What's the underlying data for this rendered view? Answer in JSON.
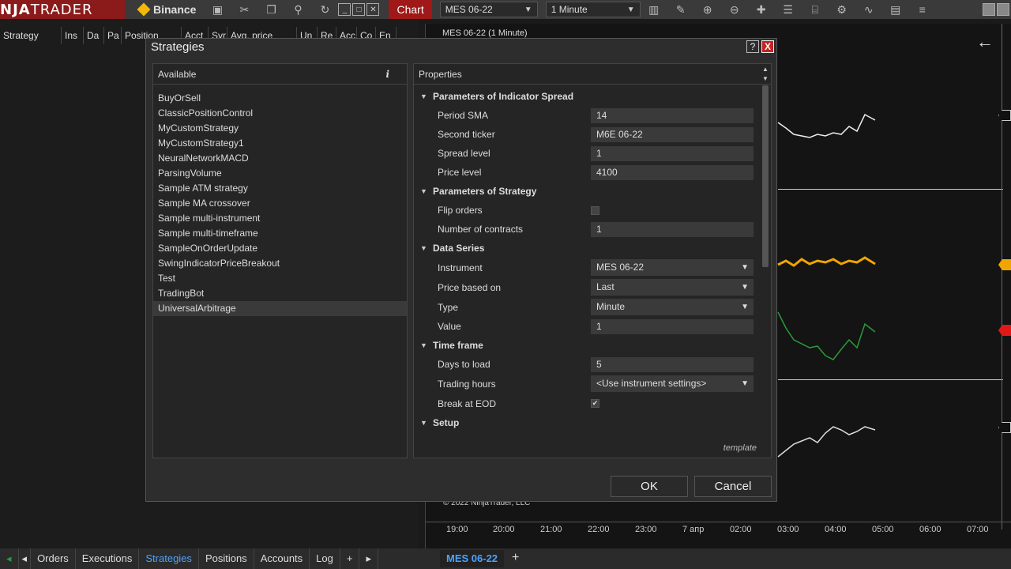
{
  "topbar": {
    "logo_prefix": "NJA",
    "logo_suffix": "TRADER",
    "connection": "Binance",
    "chart_tab": "Chart",
    "instrument": "MES 06-22",
    "interval": "1 Minute"
  },
  "grid": {
    "columns": [
      "Strategy",
      "Ins",
      "Da",
      "Pa",
      "Position",
      "Acct",
      "Syr",
      "Avg. price",
      "Un",
      "Re",
      "Acc",
      "Co",
      "En"
    ]
  },
  "chart": {
    "title": "MES 06-22 (1 Minute)",
    "copyright": "© 2022 NinjaTrader, LLC",
    "time_ticks": [
      "19:00",
      "20:00",
      "21:00",
      "22:00",
      "23:00",
      "7 апр",
      "02:00",
      "03:00",
      "04:00",
      "05:00",
      "06:00",
      "07:00"
    ],
    "marker_colors": [
      "#f0a500",
      "#e01818"
    ]
  },
  "bottom_tabs": [
    "Orders",
    "Executions",
    "Strategies",
    "Positions",
    "Accounts",
    "Log"
  ],
  "chart_tab_label": "MES 06-22",
  "dialog": {
    "title": "Strategies",
    "help": "?",
    "close": "X",
    "available_header": "Available",
    "available_info": "i",
    "available": [
      "BuyOrSell",
      "ClassicPositionControl",
      "MyCustomStrategy",
      "MyCustomStrategy1",
      "NeuralNetworkMACD",
      "ParsingVolume",
      "Sample ATM strategy",
      "Sample MA crossover",
      "Sample multi-instrument",
      "Sample multi-timeframe",
      "SampleOnOrderUpdate",
      "SwingIndicatorPriceBreakout",
      "Test",
      "TradingBot",
      "UniversalArbitrage"
    ],
    "selected": "UniversalArbitrage",
    "properties_header": "Properties",
    "categories": {
      "indicator": "Parameters of Indicator Spread",
      "strategy": "Parameters of Strategy",
      "data_series": "Data Series",
      "time_frame": "Time frame",
      "setup": "Setup"
    },
    "fields": {
      "period_sma": {
        "label": "Period SMA",
        "value": "14"
      },
      "second_ticker": {
        "label": "Second ticker",
        "value": "M6E 06-22"
      },
      "spread_level": {
        "label": "Spread level",
        "value": "1"
      },
      "price_level": {
        "label": "Price level",
        "value": "4100"
      },
      "flip_orders": {
        "label": "Flip orders",
        "value": ""
      },
      "num_contracts": {
        "label": "Number of contracts",
        "value": "1"
      },
      "instrument": {
        "label": "Instrument",
        "value": "MES 06-22"
      },
      "price_based_on": {
        "label": "Price based on",
        "value": "Last"
      },
      "type": {
        "label": "Type",
        "value": "Minute"
      },
      "value": {
        "label": "Value",
        "value": "1"
      },
      "days_to_load": {
        "label": "Days to load",
        "value": "5"
      },
      "trading_hours": {
        "label": "Trading hours",
        "value": "<Use instrument settings>"
      },
      "break_at_eod": {
        "label": "Break at EOD",
        "value": "✔"
      }
    },
    "template_link": "template",
    "ok": "OK",
    "cancel": "Cancel"
  }
}
